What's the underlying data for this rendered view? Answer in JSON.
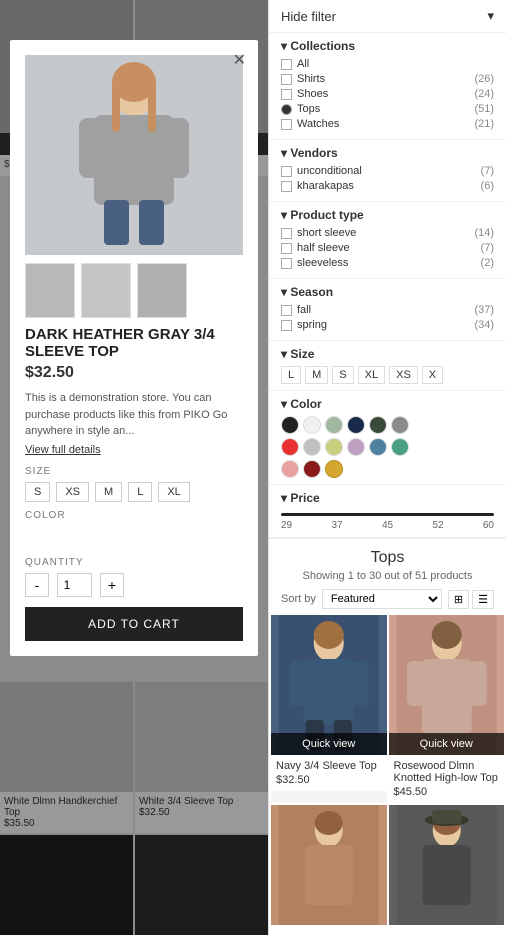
{
  "filter": {
    "header": "Hide filter",
    "chevron": "▾",
    "collections": {
      "title": "Collections",
      "items": [
        {
          "label": "All",
          "count": null,
          "checked": false
        },
        {
          "label": "Shirts",
          "count": "(26)",
          "checked": false
        },
        {
          "label": "Shoes",
          "count": "(24)",
          "checked": false
        },
        {
          "label": "Tops",
          "count": "(51)",
          "checked": true
        },
        {
          "label": "Watches",
          "count": "(21)",
          "checked": false
        }
      ]
    },
    "vendors": {
      "title": "Vendors",
      "items": [
        {
          "label": "unconditional",
          "count": "(7)",
          "checked": false
        },
        {
          "label": "kharakapas",
          "count": "(6)",
          "checked": false
        }
      ]
    },
    "product_type": {
      "title": "Product type",
      "items": [
        {
          "label": "short sleeve",
          "count": "(14)",
          "checked": false
        },
        {
          "label": "half sleeve",
          "count": "(7)",
          "checked": false
        },
        {
          "label": "sleeveless",
          "count": "(2)",
          "checked": false
        }
      ]
    },
    "season": {
      "title": "Season",
      "items": [
        {
          "label": "fall",
          "count": "(37)",
          "checked": false
        },
        {
          "label": "spring",
          "count": "(34)",
          "checked": false
        }
      ]
    },
    "size": {
      "title": "Size",
      "options": [
        "L",
        "M",
        "S",
        "XL",
        "XS",
        "X"
      ]
    },
    "color": {
      "title": "Color",
      "colors": [
        "#222222",
        "#f0f0f0",
        "#a0b8a0",
        "#1a2a4a",
        "#3a4a3a",
        "#8a8a8a",
        "#e83030",
        "#c0c0c0",
        "#c8d080",
        "#c0a0c0",
        "#5080a0",
        "#48a080",
        "#e8a0a0",
        "#8a1a1a",
        "#d4a830"
      ]
    },
    "price": {
      "title": "Price",
      "min": "29",
      "values": [
        "29",
        "37",
        "45",
        "52",
        "60"
      ],
      "max": "60"
    }
  },
  "listing": {
    "title": "Tops",
    "count_text": "Showing 1 to 30 out of 51 products",
    "sort_label": "Sort by",
    "sort_value": "Featured",
    "products": [
      {
        "name": "Navy 3/4 Sleeve Top",
        "price": "$32.50",
        "bg": "#4a6080"
      },
      {
        "name": "Rosewood Dlmn Knotted High-low Top",
        "price": "$45.50",
        "bg": "#c09080"
      }
    ],
    "products_row2": [
      {
        "name": "",
        "price": "",
        "bg": "#c09070"
      },
      {
        "name": "",
        "price": "",
        "bg": "#707070"
      }
    ]
  },
  "modal": {
    "title": "DARK HEATHER GRAY 3/4 SLEEVE TOP",
    "price": "$32.50",
    "description": "This is a demonstration store. You can purchase products like this from PIKO Go anywhere in style an...",
    "view_details": "View full details",
    "size_label": "SIZE",
    "sizes": [
      "S",
      "XS",
      "M",
      "L",
      "XL"
    ],
    "color_label": "COLOR",
    "quantity_label": "QUANTITY",
    "qty_minus": "-",
    "qty_value": "1",
    "qty_plus": "+",
    "add_to_cart": "ADD TO CART",
    "close": "✕",
    "bg_color": "#c0c0c0"
  },
  "bg_products": [
    {
      "name": "White Dlmn Handkerchief Top",
      "price": "$35.50",
      "bg": "#d0d0d0"
    },
    {
      "name": "White 3/4 Sleeve Top",
      "price": "$32.50",
      "bg": "#d5d5d5"
    }
  ],
  "bottom_bg_products": [
    {
      "name": "",
      "price": "",
      "bg": "#202020"
    },
    {
      "name": "",
      "price": "",
      "bg": "#303030"
    }
  ]
}
